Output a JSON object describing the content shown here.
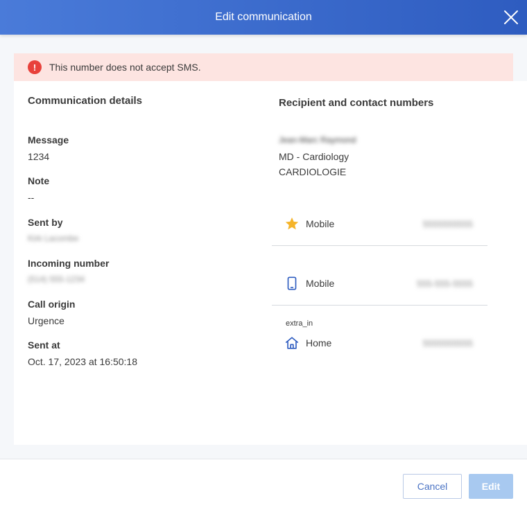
{
  "header": {
    "title": "Edit communication"
  },
  "banner": {
    "icon": "exclamation-icon",
    "text": "This number does not accept SMS."
  },
  "details": {
    "title": "Communication details",
    "fields": [
      {
        "label": "Message",
        "value": "1234"
      },
      {
        "label": "Note",
        "value": "--"
      },
      {
        "label": "Sent by",
        "value": "Kirk Lacombe"
      },
      {
        "label": "Incoming number",
        "value": "(514) 555-1234"
      },
      {
        "label": "Call origin",
        "value": "Urgence"
      },
      {
        "label": "Sent at",
        "value": "Oct. 17, 2023 at 16:50:18"
      }
    ]
  },
  "recipient": {
    "title": "Recipient and contact numbers",
    "name": "Jean-Marc Raymond",
    "role": "MD - Cardiology",
    "department": "CARDIOLOGIE",
    "contacts": [
      {
        "icon": "star-icon",
        "label": "Mobile",
        "number": "5555555555",
        "tag": ""
      },
      {
        "icon": "mobile-phone-icon",
        "label": "Mobile",
        "number": "555-555-5555",
        "tag": ""
      },
      {
        "icon": "home-icon",
        "label": "Home",
        "number": "5555555555",
        "tag": "extra_in"
      }
    ]
  },
  "footer": {
    "cancel_label": "Cancel",
    "edit_label": "Edit"
  },
  "colors": {
    "header_start": "#4a7bd9",
    "header_end": "#2e5cc0",
    "banner_bg": "#fde4e1",
    "alert_red": "#e8413b",
    "star": "#f5b42a",
    "icon_blue": "#2e5cc0",
    "edit_disabled": "#a8c9f0"
  }
}
